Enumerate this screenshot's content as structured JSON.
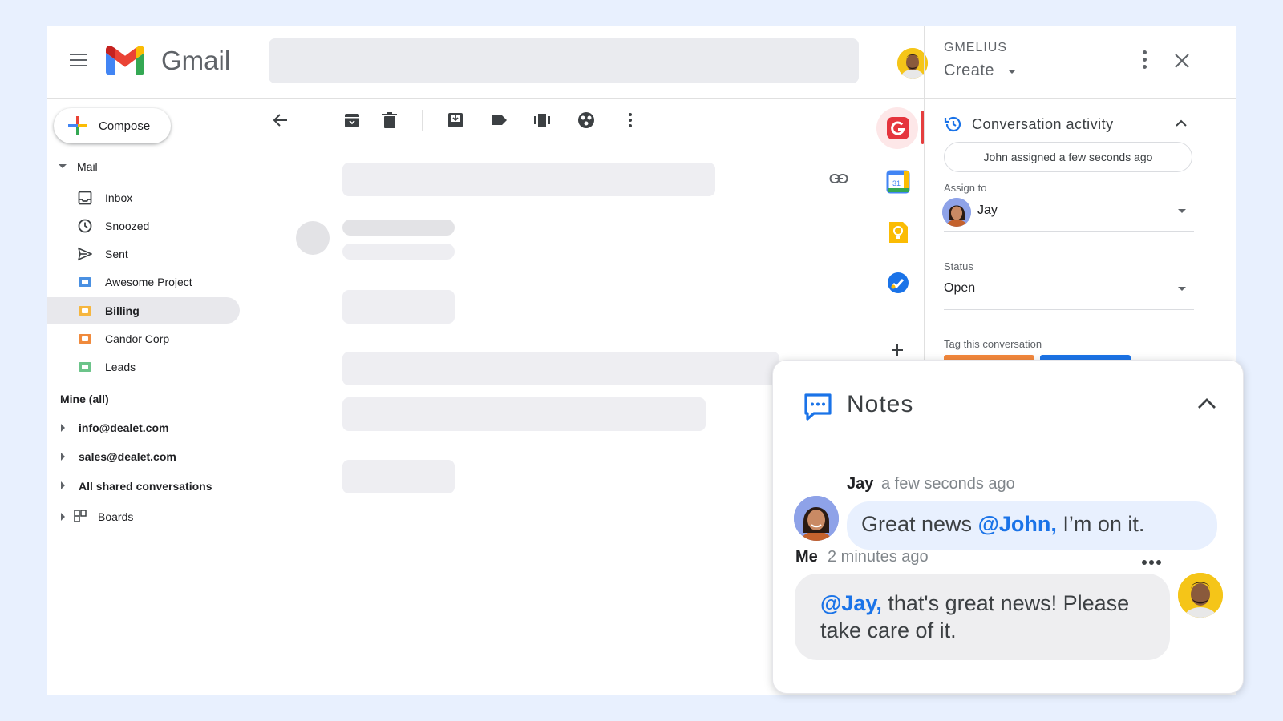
{
  "gmail": {
    "brand": "Gmail",
    "compose_label": "Compose",
    "mail_section": "Mail",
    "nav": [
      {
        "label": "Inbox"
      },
      {
        "label": "Snoozed"
      },
      {
        "label": "Sent"
      },
      {
        "label": "Awesome Project",
        "color": "#4a90e2"
      },
      {
        "label": "Billing",
        "color": "#f6b63f",
        "active": true
      },
      {
        "label": "Candor Corp",
        "color": "#f08a3c"
      },
      {
        "label": "Leads",
        "color": "#6cc48a"
      }
    ],
    "mine_label": "Mine (all)",
    "accounts": [
      "info@dealet.com",
      "sales@dealet.com",
      "All shared conversations"
    ],
    "boards_label": "Boards"
  },
  "gmelius": {
    "title": "GMELIUS",
    "create_label": "Create",
    "conversation_activity": {
      "title": "Conversation activity",
      "chip": "John assigned a few seconds ago"
    },
    "assign_to": {
      "label": "Assign to",
      "value": "Jay"
    },
    "status": {
      "label": "Status",
      "value": "Open"
    },
    "tag_label": "Tag this conversation",
    "tag_colors": [
      "#f4873a",
      "#1a73e8"
    ]
  },
  "notes": {
    "title": "Notes",
    "messages": [
      {
        "author": "Jay",
        "time": "a few seconds ago",
        "text_before": "Great news ",
        "mention": "@John,",
        "text_after": " I’m on it."
      },
      {
        "author": "Me",
        "time": "2 minutes ago",
        "mention": "@Jay,",
        "text_after": " that's great news! Please take care of it."
      }
    ]
  },
  "colors": {
    "accent_blue": "#1a73e8",
    "gmelius_red": "#e53e3e",
    "background": "#e8f0fe"
  }
}
